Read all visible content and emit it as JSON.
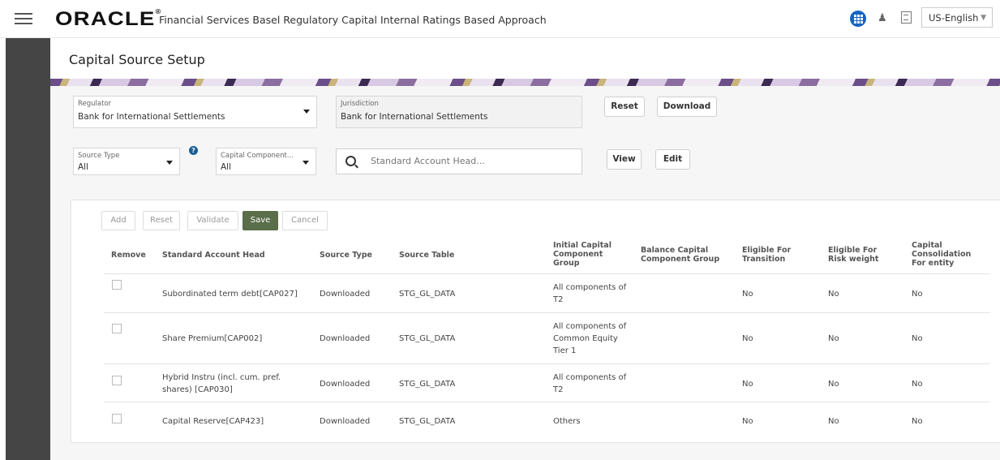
{
  "header": {
    "logo": "ORACLE",
    "app_title": "Financial Services Basel Regulatory Capital Internal Ratings Based Approach",
    "language": "US-English"
  },
  "page": {
    "title": "Capital Source Setup"
  },
  "filters": {
    "regulator": {
      "label": "Regulator",
      "value": "Bank for International Settlements"
    },
    "jurisdiction": {
      "label": "Jurisdiction",
      "value": "Bank for International Settlements"
    },
    "reset_label": "Reset",
    "download_label": "Download",
    "source_type": {
      "label": "Source Type",
      "value": "All"
    },
    "capital_component": {
      "label": "Capital Component...",
      "value": "All"
    },
    "search_placeholder": "Standard Account Head...",
    "view_label": "View",
    "edit_label": "Edit"
  },
  "table_toolbar": {
    "add": "Add",
    "reset": "Reset",
    "validate": "Validate",
    "save": "Save",
    "cancel": "Cancel"
  },
  "table": {
    "columns": {
      "remove": "Remove",
      "standard_account_head": "Standard Account Head",
      "source_type": "Source Type",
      "source_table": "Source Table",
      "initial_capital": "Initial Capital Component Group",
      "balance_capital": "Balance Capital Component Group",
      "eligible_transition": "Eligible For Transition",
      "eligible_risk": "Eligible For Risk weight",
      "capital_consolidation": "Capital Consolidation For entity"
    },
    "rows": [
      {
        "head": "Subordinated term debt[CAP027]",
        "source_type": "Downloaded",
        "source_table": "STG_GL_DATA",
        "initial": "All components of T2",
        "balance": "",
        "transition": "No",
        "risk": "No",
        "consolidation": "No"
      },
      {
        "head": "Share Premium[CAP002]",
        "source_type": "Downloaded",
        "source_table": "STG_GL_DATA",
        "initial": "All components of Common Equity Tier 1",
        "balance": "",
        "transition": "No",
        "risk": "No",
        "consolidation": "No"
      },
      {
        "head": "Hybrid Instru (incl. cum. pref. shares) [CAP030]",
        "source_type": "Downloaded",
        "source_table": "STG_GL_DATA",
        "initial": "All components of T2",
        "balance": "",
        "transition": "No",
        "risk": "No",
        "consolidation": "No"
      },
      {
        "head": "Capital Reserve[CAP423]",
        "source_type": "Downloaded",
        "source_table": "STG_GL_DATA",
        "initial": "Others",
        "balance": "",
        "transition": "No",
        "risk": "No",
        "consolidation": "No"
      }
    ]
  }
}
